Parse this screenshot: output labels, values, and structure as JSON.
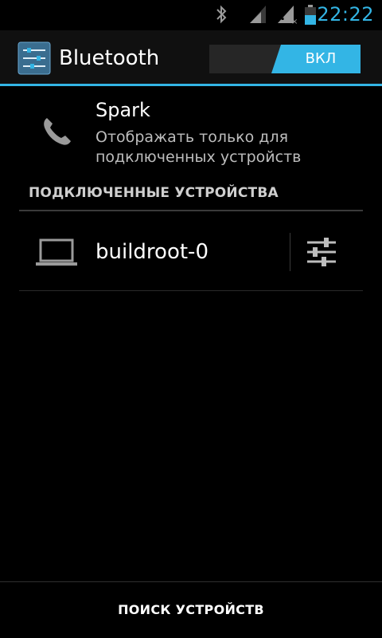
{
  "status_bar": {
    "time": "22:22",
    "icons": [
      "bluetooth-icon",
      "signal-icon",
      "sim-unknown-icon",
      "battery-icon"
    ]
  },
  "action_bar": {
    "title": "Bluetooth",
    "toggle_label": "ВКЛ",
    "toggle_state": "on",
    "accent_color": "#33b5e5"
  },
  "device_header": {
    "name": "Spark",
    "subtitle": "Отображать только для подключенных устройств"
  },
  "section": {
    "header": "ПОДКЛЮЧЕННЫЕ УСТРОЙСТВА",
    "devices": [
      {
        "name": "buildroot-0",
        "icon": "laptop-icon"
      }
    ]
  },
  "bottom": {
    "search_label": "ПОИСК УСТРОЙСТВ"
  }
}
